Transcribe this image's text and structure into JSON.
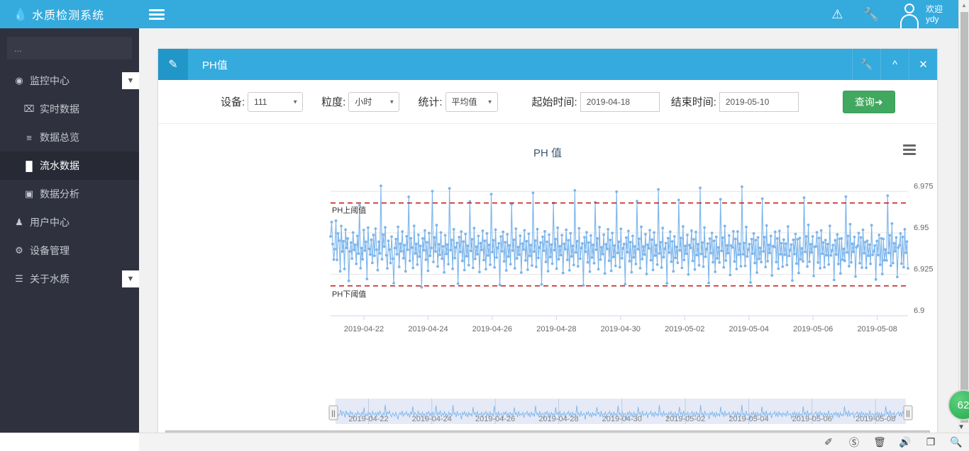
{
  "brand": {
    "logo_icon": "water-drop-icon",
    "title": "水质检测系统"
  },
  "sidebar": {
    "search_placeholder": "...",
    "search_value": "...",
    "items": [
      {
        "label": "监控中心",
        "icon": "eye-icon",
        "level": 0,
        "active": false,
        "caret": "chevron-down-icon"
      },
      {
        "label": "实时数据",
        "icon": "inbox-icon",
        "level": 1,
        "active": false,
        "caret": ""
      },
      {
        "label": "数据总览",
        "icon": "list-icon",
        "level": 1,
        "active": false,
        "caret": ""
      },
      {
        "label": "流水数据",
        "icon": "bar-chart-icon",
        "level": 1,
        "active": true,
        "caret": ""
      },
      {
        "label": "数据分析",
        "icon": "chart-area-icon",
        "level": 1,
        "active": false,
        "caret": ""
      },
      {
        "label": "用户中心",
        "icon": "user-icon",
        "level": 0,
        "active": false,
        "caret": ""
      },
      {
        "label": "设备管理",
        "icon": "gears-icon",
        "level": 0,
        "active": false,
        "caret": ""
      },
      {
        "label": "关于水质",
        "icon": "book-icon",
        "level": 0,
        "active": false,
        "caret": "chevron-down-icon"
      }
    ]
  },
  "topbar": {
    "menu_toggle_icon": "hamburger-icon",
    "warning_icon": "warning-triangle-icon",
    "settings_icon": "wrench-icon",
    "avatar_icon": "user-avatar-icon",
    "welcome_line1": "欢迎",
    "welcome_line2": "ydy"
  },
  "panel": {
    "header_icon": "edit-square-icon",
    "title": "PH值",
    "tools": [
      {
        "name": "panel-config-button",
        "icon": "wrench-icon",
        "glyph": "⚒"
      },
      {
        "name": "panel-collapse-button",
        "icon": "chevron-up-icon",
        "glyph": "⌃"
      },
      {
        "name": "panel-close-button",
        "icon": "close-icon",
        "glyph": "✕"
      }
    ]
  },
  "form": {
    "device_label": "设备:",
    "device_value": "111",
    "granularity_label": "粒度:",
    "granularity_value": "小时",
    "stat_label": "统计:",
    "stat_value": "平均值",
    "start_label": "起始时间:",
    "start_value": "2019-04-18",
    "end_label": "结束时间:",
    "end_value": "2019-05-10",
    "query_label": "查询➜"
  },
  "chart_menu_icon": "hamburger-menu-icon",
  "float_badge": {
    "text": "62",
    "color": "#33b55a",
    "caret_icon": "chevron-down-icon"
  },
  "taskbar": {
    "icons": [
      {
        "name": "pin-off-icon",
        "glyph": "✐"
      },
      {
        "name": "compass-icon",
        "glyph": "ⓘ"
      },
      {
        "name": "trash-icon",
        "glyph": "Ὕ1"
      },
      {
        "name": "speaker-icon",
        "glyph": "ὐA"
      },
      {
        "name": "window-icon",
        "glyph": "❐"
      },
      {
        "name": "search-icon",
        "glyph": "ὐD"
      }
    ]
  },
  "chart_data": {
    "type": "line",
    "title": "PH 值",
    "xlabel": "",
    "ylabel": "",
    "ylim": [
      6.9,
      6.9875
    ],
    "yticks": [
      "6.9",
      "6.925",
      "6.95",
      "6.975"
    ],
    "ytick_values": [
      6.9,
      6.925,
      6.95,
      6.975
    ],
    "xticks": [
      "2019-04-22",
      "2019-04-24",
      "2019-04-26",
      "2019-04-28",
      "2019-04-30",
      "2019-05-02",
      "2019-05-04",
      "2019-05-06",
      "2019-05-08"
    ],
    "x_range": [
      "2019-04-21",
      "2019-05-09"
    ],
    "grid": true,
    "legend": "none",
    "series_color": "#7cb5ec",
    "marker": "circle",
    "annotations": [
      {
        "label": "PH上阈值",
        "value": 6.968,
        "color": "#c00000",
        "style": "dashed"
      },
      {
        "label": "PH下阈值",
        "value": 6.918,
        "color": "#c00000",
        "style": "dashed"
      }
    ],
    "values": [
      6.9478,
      6.9565,
      6.9432,
      6.9339,
      6.9402,
      6.9573,
      6.9337,
      6.9496,
      6.9453,
      6.9268,
      6.9541,
      6.9387,
      6.9449,
      6.9282,
      6.9519,
      6.9409,
      6.9466,
      6.9211,
      6.9388,
      6.9441,
      6.9345,
      6.9502,
      6.9397,
      6.9428,
      6.9313,
      6.9481,
      6.9375,
      6.9667,
      6.9287,
      6.9408,
      6.9341,
      6.9517,
      6.9393,
      6.9446,
      6.9222,
      6.9531,
      6.9404,
      6.9369,
      6.9458,
      6.9319,
      6.9487,
      6.9362,
      6.9525,
      6.9398,
      6.9275,
      6.9446,
      6.9376,
      6.9783,
      6.9341,
      6.9489,
      6.9417,
      6.9533,
      6.9365,
      6.9286,
      6.9452,
      6.9399,
      6.9318,
      6.9477,
      6.9344,
      6.9197,
      6.9408,
      6.9462,
      6.9371,
      6.9536,
      6.9295,
      6.9434,
      6.9389,
      6.9508,
      6.9347,
      6.9425,
      6.9268,
      6.9479,
      6.9398,
      6.9717,
      6.9332,
      6.9467,
      6.9411,
      6.9288,
      6.9542,
      6.9376,
      6.9433,
      6.9309,
      6.9488,
      6.9357,
      6.9421,
      6.9172,
      6.9466,
      6.9395,
      6.9514,
      6.9338,
      6.9443,
      6.9271,
      6.9498,
      6.9362,
      6.9409,
      6.9751,
      6.9325,
      6.9472,
      6.9388,
      6.9546,
      6.9297,
      6.9431,
      6.9367,
      6.9502,
      6.9344,
      6.9418,
      6.9262,
      6.9485,
      6.9373,
      6.9429,
      6.9311,
      6.9768,
      6.9396,
      6.9457,
      6.9283,
      6.9521,
      6.9348,
      6.9412,
      6.9439,
      6.9193,
      6.9474,
      6.9385,
      6.9508,
      6.9331,
      6.9447,
      6.9276,
      6.9493,
      6.9359,
      6.9422,
      6.9305,
      6.9689,
      6.9391,
      6.9461,
      6.9289,
      6.9528,
      6.9343,
      6.9416,
      6.9371,
      6.9481,
      6.9264,
      6.9438,
      6.9397,
      6.9512,
      6.9336,
      6.9452,
      6.9281,
      6.9496,
      6.9364,
      6.9427,
      6.9308,
      6.9733,
      6.9384,
      6.9455,
      6.9292,
      6.9519,
      6.9351,
      6.9409,
      6.9437,
      6.9186,
      6.9478,
      6.9389,
      6.9506,
      6.9328,
      6.9443,
      6.9273,
      6.9491,
      6.9357,
      6.9424,
      6.9311,
      6.9672,
      6.9393,
      6.9458,
      6.9286,
      6.9525,
      6.9346,
      6.9414,
      6.9368,
      6.9483,
      6.9261,
      6.9435,
      6.9399,
      6.9515,
      6.9334,
      6.9449,
      6.9278,
      6.9494,
      6.9361,
      6.9426,
      6.9303,
      6.9741,
      6.9387,
      6.9453,
      6.9295,
      6.9522,
      6.9349,
      6.9411,
      6.9441,
      6.9189,
      6.9476,
      6.9392,
      6.9509,
      6.9325,
      6.9446,
      6.9269,
      6.9488,
      6.9354,
      6.9429,
      6.9314,
      6.9679,
      6.9396,
      6.9462,
      6.9284,
      6.9531,
      6.9341,
      6.9419,
      6.9366,
      6.9486,
      6.9258,
      6.9433,
      6.9401,
      6.9518,
      6.9337,
      6.9455,
      6.9274,
      6.9497,
      6.9358,
      6.9421,
      6.9306,
      6.9756,
      6.9382,
      6.9449,
      6.9298,
      6.9527,
      6.9344,
      6.9408,
      6.9436,
      6.9183,
      6.9473,
      6.9386,
      6.9503,
      6.9322,
      6.9441,
      6.9266,
      6.9484,
      6.9351,
      6.9427,
      6.9317,
      6.9684,
      6.9398,
      6.9466,
      6.9281,
      6.9534,
      6.9339,
      6.9413,
      6.9372,
      6.9489,
      6.9255,
      6.9431,
      6.9403,
      6.9521,
      6.9332,
      6.9457,
      6.9271,
      6.9499,
      6.9355,
      6.9423,
      6.9301,
      6.9748,
      6.9379,
      6.9446,
      6.9293,
      6.9524,
      6.9347,
      6.9406,
      6.9433,
      6.9191,
      6.9471,
      6.9383,
      6.9511,
      6.9329,
      6.9444,
      6.9263,
      6.9481,
      6.9352,
      6.9418,
      6.9312,
      6.9691,
      6.9401,
      6.9464,
      6.9287,
      6.9536,
      6.9342,
      6.9417,
      6.9369,
      6.9492,
      6.9252,
      6.9428,
      6.9406,
      6.9516,
      6.9335,
      6.9459,
      6.9277,
      6.9502,
      6.9363,
      6.9425,
      6.9309,
      6.9762,
      6.9376,
      6.9443,
      6.9291,
      6.9529,
      6.9353,
      6.9404,
      6.9438,
      6.9196,
      6.9468,
      6.9381,
      6.9507,
      6.9326,
      6.9448,
      6.9268,
      6.9478,
      6.9349,
      6.9415,
      6.9319,
      6.9698,
      6.9394,
      6.9469,
      6.9289,
      6.9538,
      6.9336,
      6.9421,
      6.9374,
      6.9487,
      6.9249,
      6.9426,
      6.9409,
      6.9513,
      6.9331,
      6.9461,
      6.9279,
      6.9505,
      6.9366,
      6.9431,
      6.9304,
      6.9771,
      6.9373,
      6.9441,
      6.9296,
      6.9532,
      6.9356,
      6.9402,
      6.9435,
      6.9198,
      6.9465,
      6.9378,
      6.9499,
      6.9323,
      6.9452,
      6.9265,
      6.9475,
      6.9346,
      6.9412,
      6.9321,
      6.9702,
      6.9391,
      6.9471,
      6.9292,
      6.9541,
      6.9333,
      6.9424,
      6.9377,
      6.9484,
      6.9246,
      6.9423,
      6.9412,
      6.9509,
      6.9327,
      6.9463,
      6.9282,
      6.9508,
      6.9368,
      6.9434,
      6.9299,
      6.9778,
      6.9371,
      6.9438,
      6.9301,
      6.9535,
      6.9358,
      6.9399,
      6.9432,
      6.9201,
      6.9462,
      6.9375,
      6.9496,
      6.9318,
      6.9456,
      6.9261,
      6.9472,
      6.9343,
      6.9409,
      6.9324,
      6.9706,
      6.9388,
      6.9474,
      6.9294,
      6.9544,
      6.9329,
      6.9427,
      6.9379,
      6.9481,
      6.9243,
      6.9419,
      6.9415,
      6.9506,
      6.9324,
      6.9466,
      6.9284,
      6.9511,
      6.9371,
      6.9437,
      6.9296,
      6.9459,
      6.9368,
      6.9435,
      6.9306,
      6.9538,
      6.9361,
      6.9396,
      6.9429,
      6.9213,
      6.9458,
      6.9372,
      6.9493,
      6.9315,
      6.9461,
      6.9258,
      6.9469,
      6.9341,
      6.9406,
      6.9328,
      6.9712,
      6.9385,
      6.9478,
      6.9297,
      6.9548,
      6.9326,
      6.9431,
      6.9382,
      6.9478,
      6.924,
      6.9416,
      6.9418,
      6.9503,
      6.9321,
      6.9469,
      6.9287,
      6.9514,
      6.9374,
      6.9441,
      6.9293,
      6.9456,
      6.9365,
      6.9432,
      6.9309,
      6.9542,
      6.9364,
      6.9393,
      6.9426,
      6.9216,
      6.9455,
      6.9369,
      6.949,
      6.9312,
      6.9464,
      6.9255,
      6.9466,
      6.9338,
      6.9403,
      6.9331,
      6.9718,
      6.9382,
      6.9481,
      6.9299,
      6.9552,
      6.9322,
      6.9434,
      6.9386,
      6.9475,
      6.9237,
      6.9413,
      6.9422,
      6.9499,
      6.9317,
      6.9472,
      6.929,
      6.9518,
      6.9377,
      6.9444,
      6.9289,
      6.9452,
      6.9362,
      6.9429,
      6.9313,
      6.9546,
      6.9367,
      6.9389,
      6.9423,
      6.9219,
      6.9451,
      6.9366,
      6.9487,
      6.9308,
      6.9467,
      6.9252,
      6.9463,
      6.9335,
      6.9399,
      6.9334,
      6.9724,
      6.9379,
      6.9485,
      6.9302,
      6.9556,
      6.9318,
      6.9437,
      6.9389,
      6.9472,
      6.9234,
      6.9411,
      6.9425,
      6.9496,
      6.9314,
      6.9475,
      6.9293,
      6.9521,
      6.938,
      6.9447,
      6.9286
    ]
  }
}
